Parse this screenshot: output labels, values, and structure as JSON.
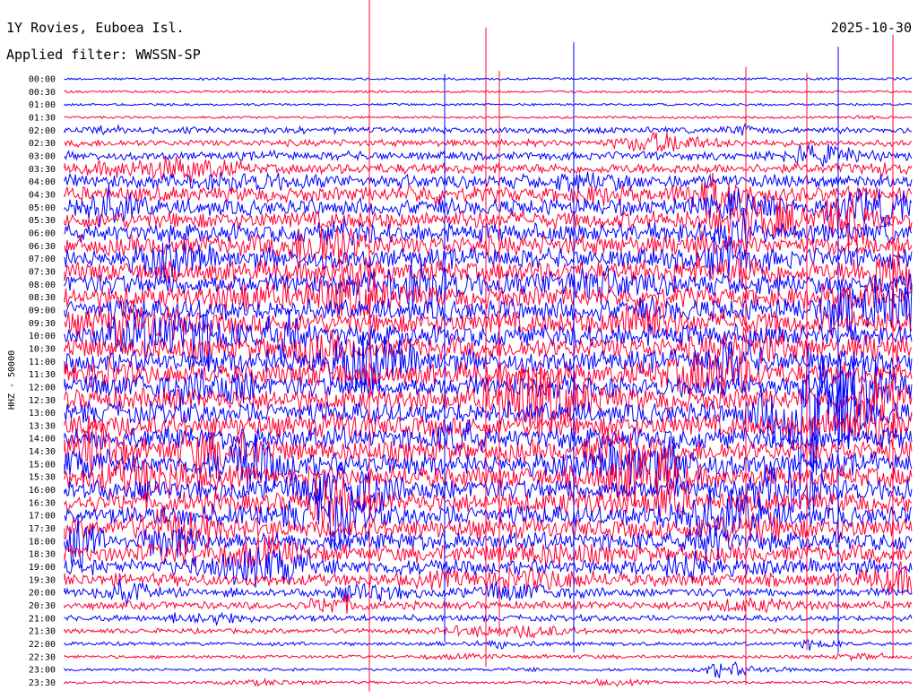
{
  "header": {
    "station": "1Y Rovies, Euboea Isl.",
    "date": "2025-10-30",
    "filter": "Applied filter: WWSSN-SP"
  },
  "chart_data": {
    "type": "line",
    "channel_label": "HHZ - 50000",
    "rows": [
      "00:00",
      "00:30",
      "01:00",
      "01:30",
      "02:00",
      "02:30",
      "03:00",
      "03:30",
      "04:00",
      "04:30",
      "05:00",
      "05:30",
      "06:00",
      "06:30",
      "07:00",
      "07:30",
      "08:00",
      "08:30",
      "09:00",
      "09:30",
      "10:00",
      "10:30",
      "11:00",
      "11:30",
      "12:00",
      "12:30",
      "13:00",
      "13:30",
      "14:00",
      "14:30",
      "15:00",
      "15:30",
      "16:00",
      "16:30",
      "17:00",
      "17:30",
      "18:00",
      "18:30",
      "19:00",
      "19:30",
      "20:00",
      "20:30",
      "21:00",
      "21:30",
      "22:00",
      "22:30",
      "23:00",
      "23:30"
    ],
    "row_colors": [
      "#0000ff",
      "#ff0033"
    ],
    "amplitude_profile": [
      0.1,
      0.12,
      0.12,
      0.16,
      0.55,
      0.6,
      0.75,
      0.95,
      1.2,
      1.35,
      1.5,
      1.6,
      1.7,
      1.8,
      1.85,
      1.9,
      1.95,
      1.95,
      2.0,
      2.0,
      2.0,
      2.0,
      2.0,
      2.0,
      2.0,
      2.0,
      2.0,
      2.0,
      2.0,
      2.0,
      2.0,
      2.0,
      2.0,
      1.9,
      1.9,
      1.8,
      1.7,
      1.6,
      1.4,
      1.2,
      0.8,
      0.7,
      0.55,
      0.45,
      0.35,
      0.3,
      0.25,
      0.25
    ]
  }
}
